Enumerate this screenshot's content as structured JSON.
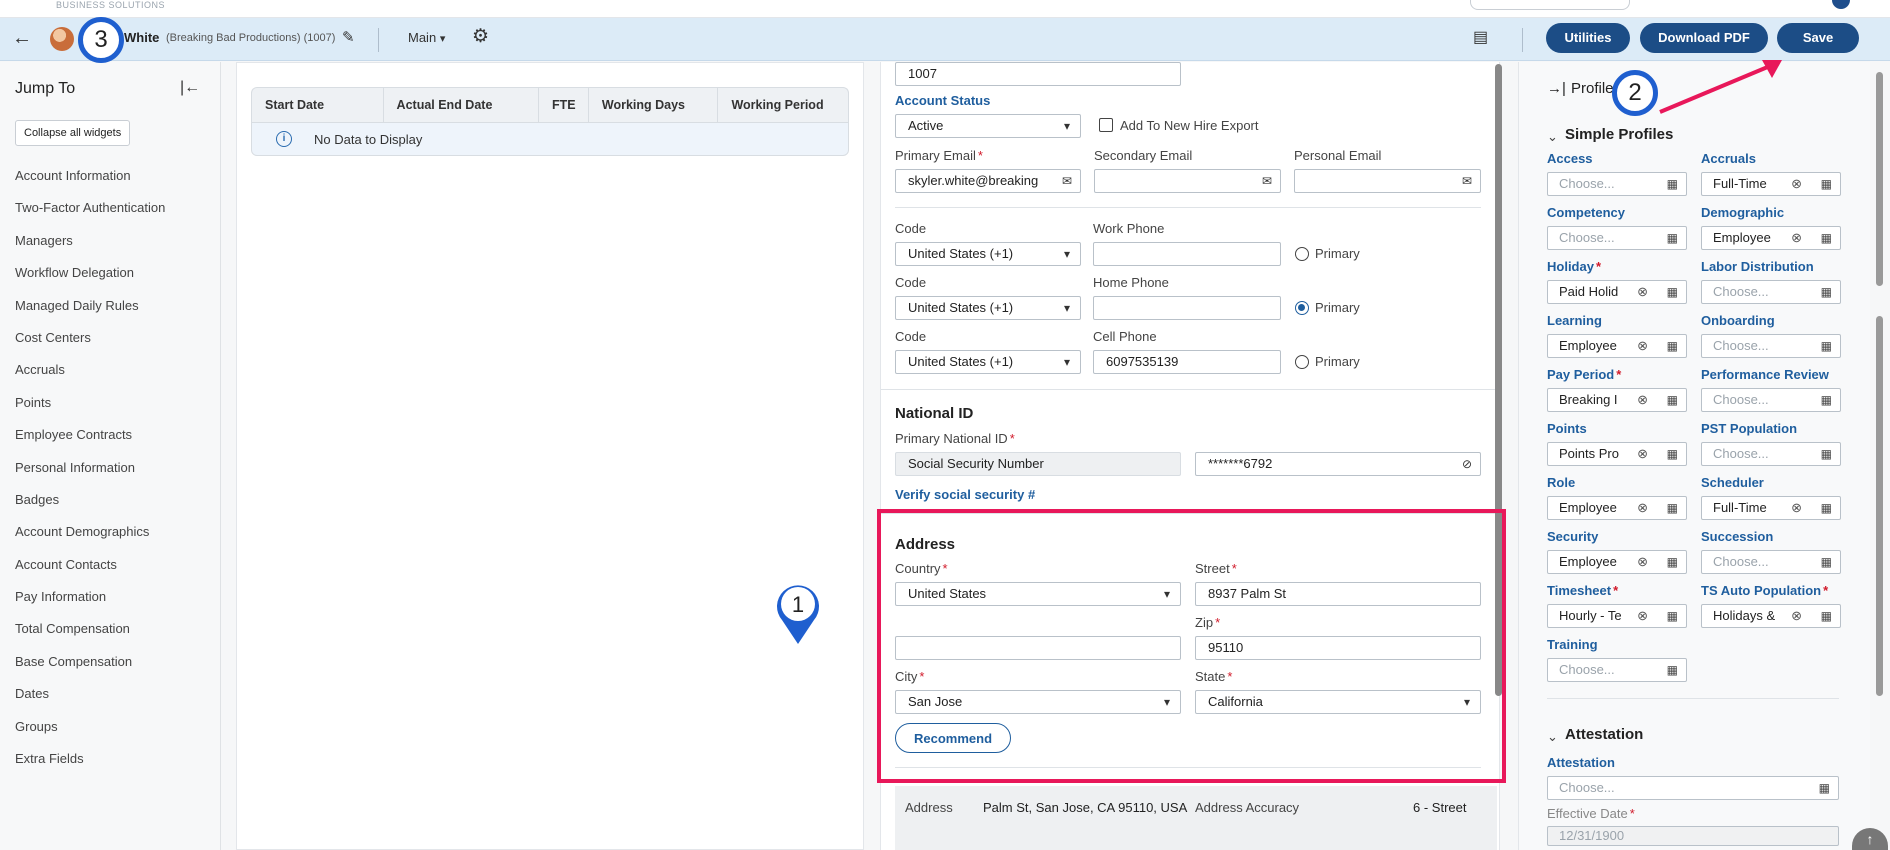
{
  "top": {
    "brand": "BUSINESS SOLUTIONS"
  },
  "header": {
    "employee_name": "White",
    "employee_meta": "(Breaking Bad Productions) (1007)",
    "view": "Main",
    "buttons": {
      "utilities": "Utilities",
      "download_pdf": "Download PDF",
      "save": "Save"
    }
  },
  "sidebar": {
    "title": "Jump To",
    "collapse_all": "Collapse all widgets",
    "items": [
      "Account Information",
      "Two-Factor Authentication",
      "Managers",
      "Workflow Delegation",
      "Managed Daily Rules",
      "Cost Centers",
      "Accruals",
      "Points",
      "Employee Contracts",
      "Personal Information",
      "Badges",
      "Account Demographics",
      "Account Contacts",
      "Pay Information",
      "Total Compensation",
      "Base Compensation",
      "Dates",
      "Groups",
      "Extra Fields"
    ]
  },
  "contracts": {
    "columns": [
      "Start Date",
      "Actual End Date",
      "FTE",
      "Working Days",
      "Working Period"
    ],
    "empty": "No Data to Display"
  },
  "form": {
    "account_id": "1007",
    "account_status_label": "Account Status",
    "account_status": "Active",
    "add_to_new_hire_export": "Add To New Hire Export",
    "primary_email_label": "Primary Email",
    "primary_email": "skyler.white@breaking",
    "secondary_email_label": "Secondary Email",
    "personal_email_label": "Personal Email",
    "code_label": "Code",
    "country_code": "United States (+1)",
    "work_phone_label": "Work Phone",
    "home_phone_label": "Home Phone",
    "cell_phone_label": "Cell Phone",
    "cell_phone": "6097535139",
    "primary_label": "Primary",
    "national_id_title": "National ID",
    "primary_national_id_label": "Primary National ID",
    "national_id_type": "Social Security Number",
    "national_id_value": "*******6792",
    "verify_ssn": "Verify social security #",
    "address_title": "Address",
    "country_label": "Country",
    "country": "United States",
    "street_label": "Street",
    "street": "8937 Palm St",
    "zip_label": "Zip",
    "zip": "95110",
    "city_label": "City",
    "city": "San Jose",
    "state_label": "State",
    "state": "California",
    "recommend": "Recommend",
    "address_summary_label": "Address",
    "address_summary": "Palm St, San Jose, CA 95110, USA",
    "address_accuracy_label": "Address Accuracy",
    "address_accuracy": "6 - Street"
  },
  "profiles": {
    "title": "Profiles",
    "simple_profiles": "Simple Profiles",
    "choose": "Choose...",
    "attestation_group": "Attestation",
    "attestation_label": "Attestation",
    "effective_date_label": "Effective Date",
    "effective_date": "12/31/1900",
    "fields": [
      {
        "label": "Access",
        "value": "",
        "req": false
      },
      {
        "label": "Accruals",
        "value": "Full-Time",
        "req": false
      },
      {
        "label": "Competency",
        "value": "",
        "req": false
      },
      {
        "label": "Demographic",
        "value": "Employee",
        "req": false
      },
      {
        "label": "Holiday",
        "value": "Paid Holid",
        "req": true
      },
      {
        "label": "Labor Distribution",
        "value": "",
        "req": false
      },
      {
        "label": "Learning",
        "value": "Employee",
        "req": false
      },
      {
        "label": "Onboarding",
        "value": "",
        "req": false
      },
      {
        "label": "Pay Period",
        "value": "Breaking I",
        "req": true
      },
      {
        "label": "Performance Review",
        "value": "",
        "req": false
      },
      {
        "label": "Points",
        "value": "Points Pro",
        "req": false
      },
      {
        "label": "PST Population",
        "value": "",
        "req": false
      },
      {
        "label": "Role",
        "value": "Employee",
        "req": false
      },
      {
        "label": "Scheduler",
        "value": "Full-Time",
        "req": false
      },
      {
        "label": "Security",
        "value": "Employee",
        "req": false
      },
      {
        "label": "Succession",
        "value": "",
        "req": false
      },
      {
        "label": "Timesheet",
        "value": "Hourly - Te",
        "req": true
      },
      {
        "label": "TS Auto Population",
        "value": "Holidays &",
        "req": true
      },
      {
        "label": "Training",
        "value": "",
        "req": false
      }
    ]
  },
  "markers": {
    "m1": "1",
    "m2": "2",
    "m3": "3"
  },
  "colors": {
    "accent": "#1c4d86",
    "highlight": "#e8185a",
    "marker": "#1f5fcf"
  }
}
